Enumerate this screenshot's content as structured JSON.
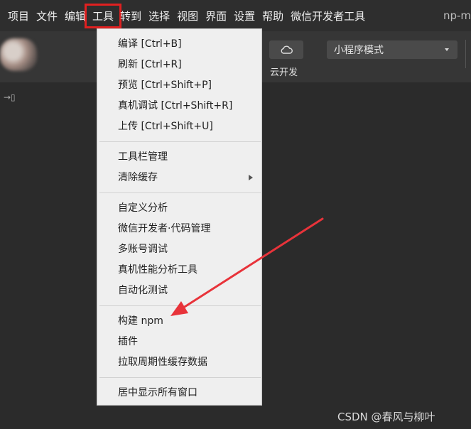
{
  "menubar": {
    "items": [
      "项目",
      "文件",
      "编辑",
      "工具",
      "转到",
      "选择",
      "视图",
      "界面",
      "设置",
      "帮助",
      "微信开发者工具"
    ],
    "right_text": "np-m"
  },
  "toolbar": {
    "cloud_label": "云开发",
    "mode_select": "小程序模式"
  },
  "dropdown": {
    "groups": [
      [
        "编译  [Ctrl+B]",
        "刷新  [Ctrl+R]",
        "预览  [Ctrl+Shift+P]",
        "真机调试  [Ctrl+Shift+R]",
        "上传  [Ctrl+Shift+U]"
      ],
      [
        "工具栏管理",
        "清除缓存"
      ],
      [
        "自定义分析",
        "微信开发者·代码管理",
        "多账号调试",
        "真机性能分析工具",
        "自动化测试"
      ],
      [
        "构建 npm",
        "插件",
        "拉取周期性缓存数据"
      ],
      [
        "居中显示所有窗口"
      ]
    ]
  },
  "watermark": "CSDN @春风与柳叶",
  "colors": {
    "highlight": "#e02020",
    "annotation_arrow": "#e8333a",
    "menu_bg": "#efefef"
  }
}
